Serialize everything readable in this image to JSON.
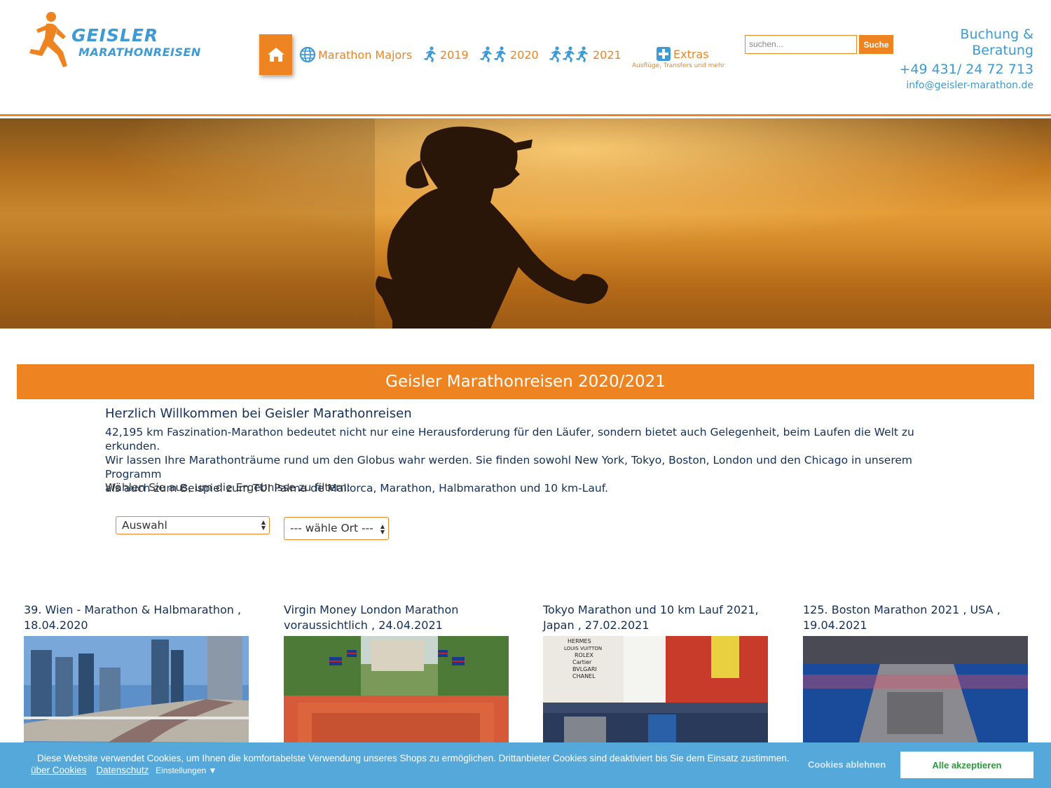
{
  "logo": {
    "line1": "GEISLER",
    "line2": "MARATHONREISEN"
  },
  "nav": {
    "items": [
      {
        "label": "Marathon Majors",
        "icon": "globe-icon"
      },
      {
        "label": "2019",
        "icon": "runner-icon"
      },
      {
        "label": "2020",
        "icon": "runners-icon"
      },
      {
        "label": "2021",
        "icon": "runners-icon"
      },
      {
        "label": "Extras",
        "icon": "plus-icon"
      }
    ],
    "extras_sub": "Ausflüge, Transfers und mehr"
  },
  "search": {
    "placeholder": "suchen...",
    "button": "Suche"
  },
  "contact": {
    "cta_line1": "Buchung &",
    "cta_line2": "Beratung",
    "phone": "+49 431/ 24 72 713",
    "email": "info@geisler-marathon.de"
  },
  "banner": {
    "title": "Geisler Marathonreisen 2020/2021"
  },
  "intro": {
    "heading": "Herzlich Willkommen bei Geisler Marathonreisen",
    "line1": "42,195 km Faszination-Marathon bedeutet nicht nur eine Herausforderung für den Läufer, sondern bietet auch Gelegenheit, beim Laufen die Welt zu erkunden.",
    "line2": "Wir lassen Ihre Marathonträume rund um den Globus wahr werden. Sie finden sowohl New York, Tokyo, Boston, London und den Chicago in unserem Programm",
    "line3": "als auch zum Beispiel zum TUI Palma de Mallorca, Marathon, Halbmarathon und 10 km-Lauf."
  },
  "filter": {
    "label": "Wählen Sie aus, um die Ergebnisse zu filtern:",
    "select1": "Auswahl",
    "select2": "--- wähle Ort ---"
  },
  "cards": [
    {
      "line1": "39. Wien - Marathon & Halbmarathon ,",
      "line2": "18.04.2020"
    },
    {
      "line1": "Virgin Money London Marathon",
      "line2": "voraussichtlich , 24.04.2021"
    },
    {
      "line1": "Tokyo Marathon und 10 km Lauf 2021,",
      "line2": "Japan , 27.02.2021"
    },
    {
      "line1": "125. Boston Marathon 2021 , USA ,",
      "line2": "19.04.2021"
    }
  ],
  "tokyo_sign": [
    "HERMES",
    "LOUIS VUITTON",
    "ROLEX",
    "Cartier",
    "BVLGARI",
    "CHANEL"
  ],
  "cookie": {
    "text": "Diese Website verwendet Cookies, um Ihnen die komfortabelste Verwendung unseres Shops zu ermöglichen.   Drittanbieter Cookies sind deaktiviert bis Sie dem Einsatz zustimmen.",
    "link1": "über Cookies",
    "link2": "Datenschutz",
    "settings": "Einstellungen",
    "settings_arrow": "▼",
    "decline": "Cookies ablehnen",
    "accept": "Alle akzeptieren"
  },
  "colors": {
    "accent": "#ee8421",
    "blue": "#3d9ad4",
    "navy": "#12305a",
    "cookie_bg": "#55a8da"
  }
}
